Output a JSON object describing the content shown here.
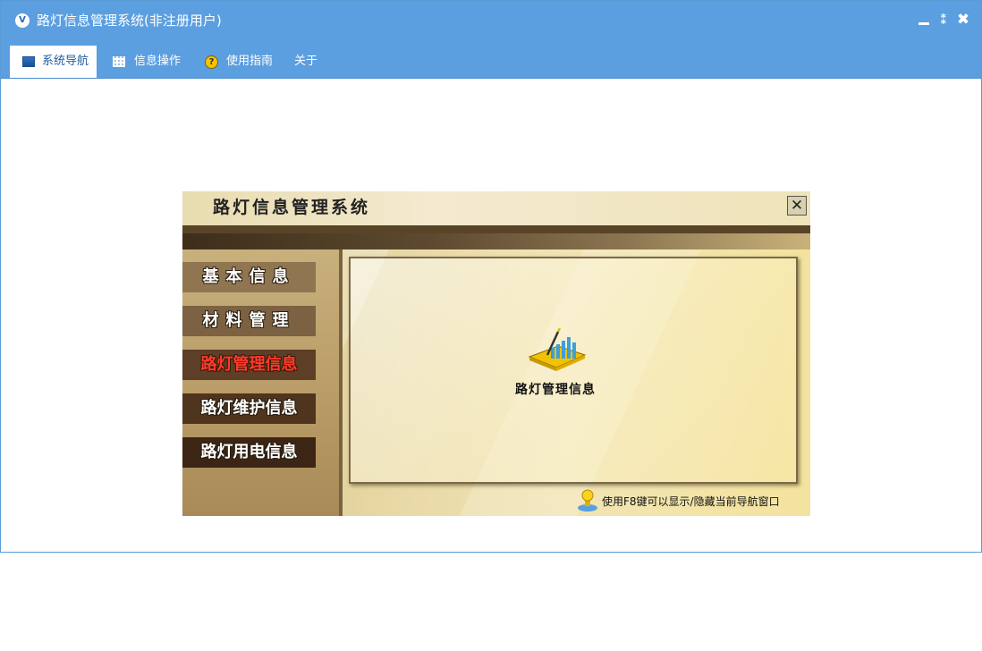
{
  "window": {
    "title": "路灯信息管理系统(非注册用户)",
    "logo_text": "V",
    "controls": {
      "restore": "⁑",
      "close": "✖"
    }
  },
  "menu": {
    "tabs": [
      {
        "label": "系统导航",
        "icon": "monitor-icon",
        "active": true
      },
      {
        "label": "信息操作",
        "icon": "grid-icon",
        "active": false
      },
      {
        "label": "使用指南",
        "icon": "help-icon",
        "active": false
      },
      {
        "label": "关于",
        "icon": "",
        "active": false
      }
    ],
    "help_glyph": "?"
  },
  "navigator": {
    "title": "路灯信息管理系统",
    "close_glyph": "✕",
    "buttons": [
      {
        "label": "基本信息",
        "active": false
      },
      {
        "label": "材料管理",
        "active": false
      },
      {
        "label": "路灯管理信息",
        "active": true
      },
      {
        "label": "路灯维护信息",
        "active": false
      },
      {
        "label": "路灯用电信息",
        "active": false
      }
    ],
    "content_label": "路灯管理信息",
    "hint": "使用F8键可以显示/隐藏当前导航窗口"
  },
  "colors": {
    "title_bar": "#5b9fe0",
    "active_nav_text": "#ff3a2a"
  }
}
